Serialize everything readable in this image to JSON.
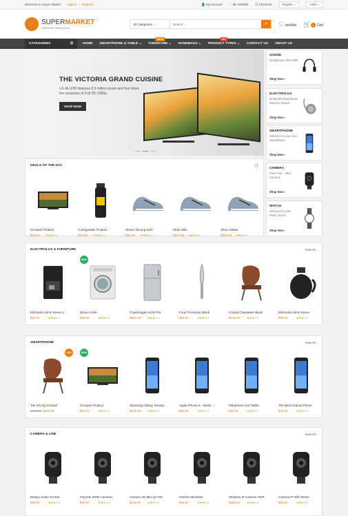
{
  "topbar": {
    "welcome": "Welcome to Super Market",
    "signin": "Sign in",
    "register": "Register",
    "account": "My Account",
    "wishlist": "My Wishlist",
    "checkout": "Checkout",
    "language": "English",
    "currency": "USD"
  },
  "header": {
    "logo_a": "SUPER",
    "logo_b": "MARKET",
    "logo_sub": "Wholesale Marketplace",
    "category_select": "All Categories",
    "search_placeholder": "Search ...",
    "wishlist_label": "wishlist",
    "cart_label": "Cart",
    "cart_count": "0"
  },
  "nav": {
    "categories": "CATEGORIES",
    "items": [
      {
        "label": "HOME"
      },
      {
        "label": "SMARTPHONE & TABLE ⌄"
      },
      {
        "label": "FURNITURE ⌄",
        "badge": "SALE",
        "badge_color": "#f57c00"
      },
      {
        "label": "HANDBAGS ⌄"
      },
      {
        "label": "PRODUCT TYPES ⌄",
        "badge": "HOT",
        "badge_color": "#e53935"
      },
      {
        "label": "CONTACT US"
      },
      {
        "label": "ABOUT US"
      }
    ]
  },
  "hero": {
    "title": "THE VICTORIA GRAND CUISINE",
    "text": "LG 4k UHD features 8.3 million pixels and four times the resolution of Full HD 1080p.",
    "button": "SHOP NOW"
  },
  "side_promos": [
    {
      "title": "SOUND",
      "desc": "Headphone CDs 4000",
      "link": "Shop Now ›",
      "icon": "headphones-icon"
    },
    {
      "title": "ELECTROLUX",
      "desc": "ECM1200 EasySense Vacuum cleaner",
      "link": "Shop Now ›",
      "icon": "vacuum-icon"
    },
    {
      "title": "SMARTPHONE",
      "desc": "Solution for your Acer Smartphone",
      "link": "Shop Now ›",
      "icon": "phone-icon"
    },
    {
      "title": "CAMERA",
      "desc": "Point-And - Shot Camera",
      "link": "Shop Now ›",
      "icon": "camera-icon"
    },
    {
      "title": "WATCH",
      "desc": "Solution for your Watch men's",
      "link": "Shop Now ›",
      "icon": "watch-icon"
    }
  ],
  "deals": {
    "title": "DEALS OF THE DAY",
    "products": [
      {
        "name": "Grouped Product",
        "price": "$20.00",
        "icon": "tv-icon"
      },
      {
        "name": "Configurable Product",
        "price": "$43.00",
        "icon": "bottle-icon"
      },
      {
        "name": "Shoes Thuong Dinh",
        "price": "$50.00",
        "icon": "shoe-icon"
      },
      {
        "name": "Shoe Nike",
        "price": "$120.00",
        "icon": "shoe-icon"
      },
      {
        "name": "Shoe Adidas",
        "price": "$350.00",
        "icon": "shoe-icon"
      }
    ]
  },
  "sections": [
    {
      "title": "ELECTROLUX & FURNITURE",
      "view_all": "View All ›",
      "products": [
        {
          "name": "Electrolux Wms Seven 2",
          "price": "$60.00",
          "icon": "coffee-machine-icon"
        },
        {
          "name": "Dinner Knife",
          "price": "$50.00",
          "icon": "washer-icon",
          "new": "NEW"
        },
        {
          "name": "Copenhagen Knife Pot",
          "price": "$500.00",
          "icon": "fridge-icon"
        },
        {
          "name": "Food Processor Black",
          "price": "$55.00",
          "icon": "knife-icon"
        },
        {
          "name": "Crystal Chandelier Black",
          "price": "$100.00",
          "icon": "chair-icon"
        },
        {
          "name": "Electrolux Wms Seven",
          "price": "$50.00",
          "icon": "kettle-icon"
        }
      ]
    },
    {
      "title": "SMARTPHONE",
      "view_all": "View All ›",
      "products": [
        {
          "name": "Tier Pricing Product",
          "old_price": "$432.00",
          "price": "$250.00",
          "icon": "chair-icon",
          "sale": "-43%"
        },
        {
          "name": "Grouped Product",
          "price": "$20.00",
          "icon": "tv-icon",
          "new": "NEW"
        },
        {
          "name": "Samsung Galaxy Smartp...",
          "price": "$150.00",
          "icon": "phone-icon"
        },
        {
          "name": "Apple iPhone 6 - 64GB -...",
          "price": "$50.00",
          "icon": "phone-icon"
        },
        {
          "name": "Martphone And Tablet",
          "price": "$50.00",
          "icon": "phone-icon"
        },
        {
          "name": "The Best Android Phone",
          "price": "$45.00",
          "icon": "phone-icon"
        }
      ]
    },
    {
      "title": "CAMERA & USB",
      "view_all": "View All ›",
      "products": [
        {
          "name": "Beatvo Solo2 On-Ear",
          "price": "$50.00",
          "icon": "camera-icon"
        },
        {
          "name": "Favorite IZON Camerac",
          "price": "$56.00",
          "icon": "camera-icon"
        },
        {
          "name": "Camera 3G Mini Q7 HD",
          "price": "$140.00",
          "icon": "camera-icon"
        },
        {
          "name": "Fashion Bluesher",
          "price": "$69.00",
          "icon": "camera-icon"
        },
        {
          "name": "Wireless IP Camera 720P",
          "price": "$350.00",
          "icon": "camera-icon"
        },
        {
          "name": "Camera IP Wifi OKISA",
          "price": "$50.00",
          "icon": "camera-icon"
        }
      ]
    }
  ]
}
